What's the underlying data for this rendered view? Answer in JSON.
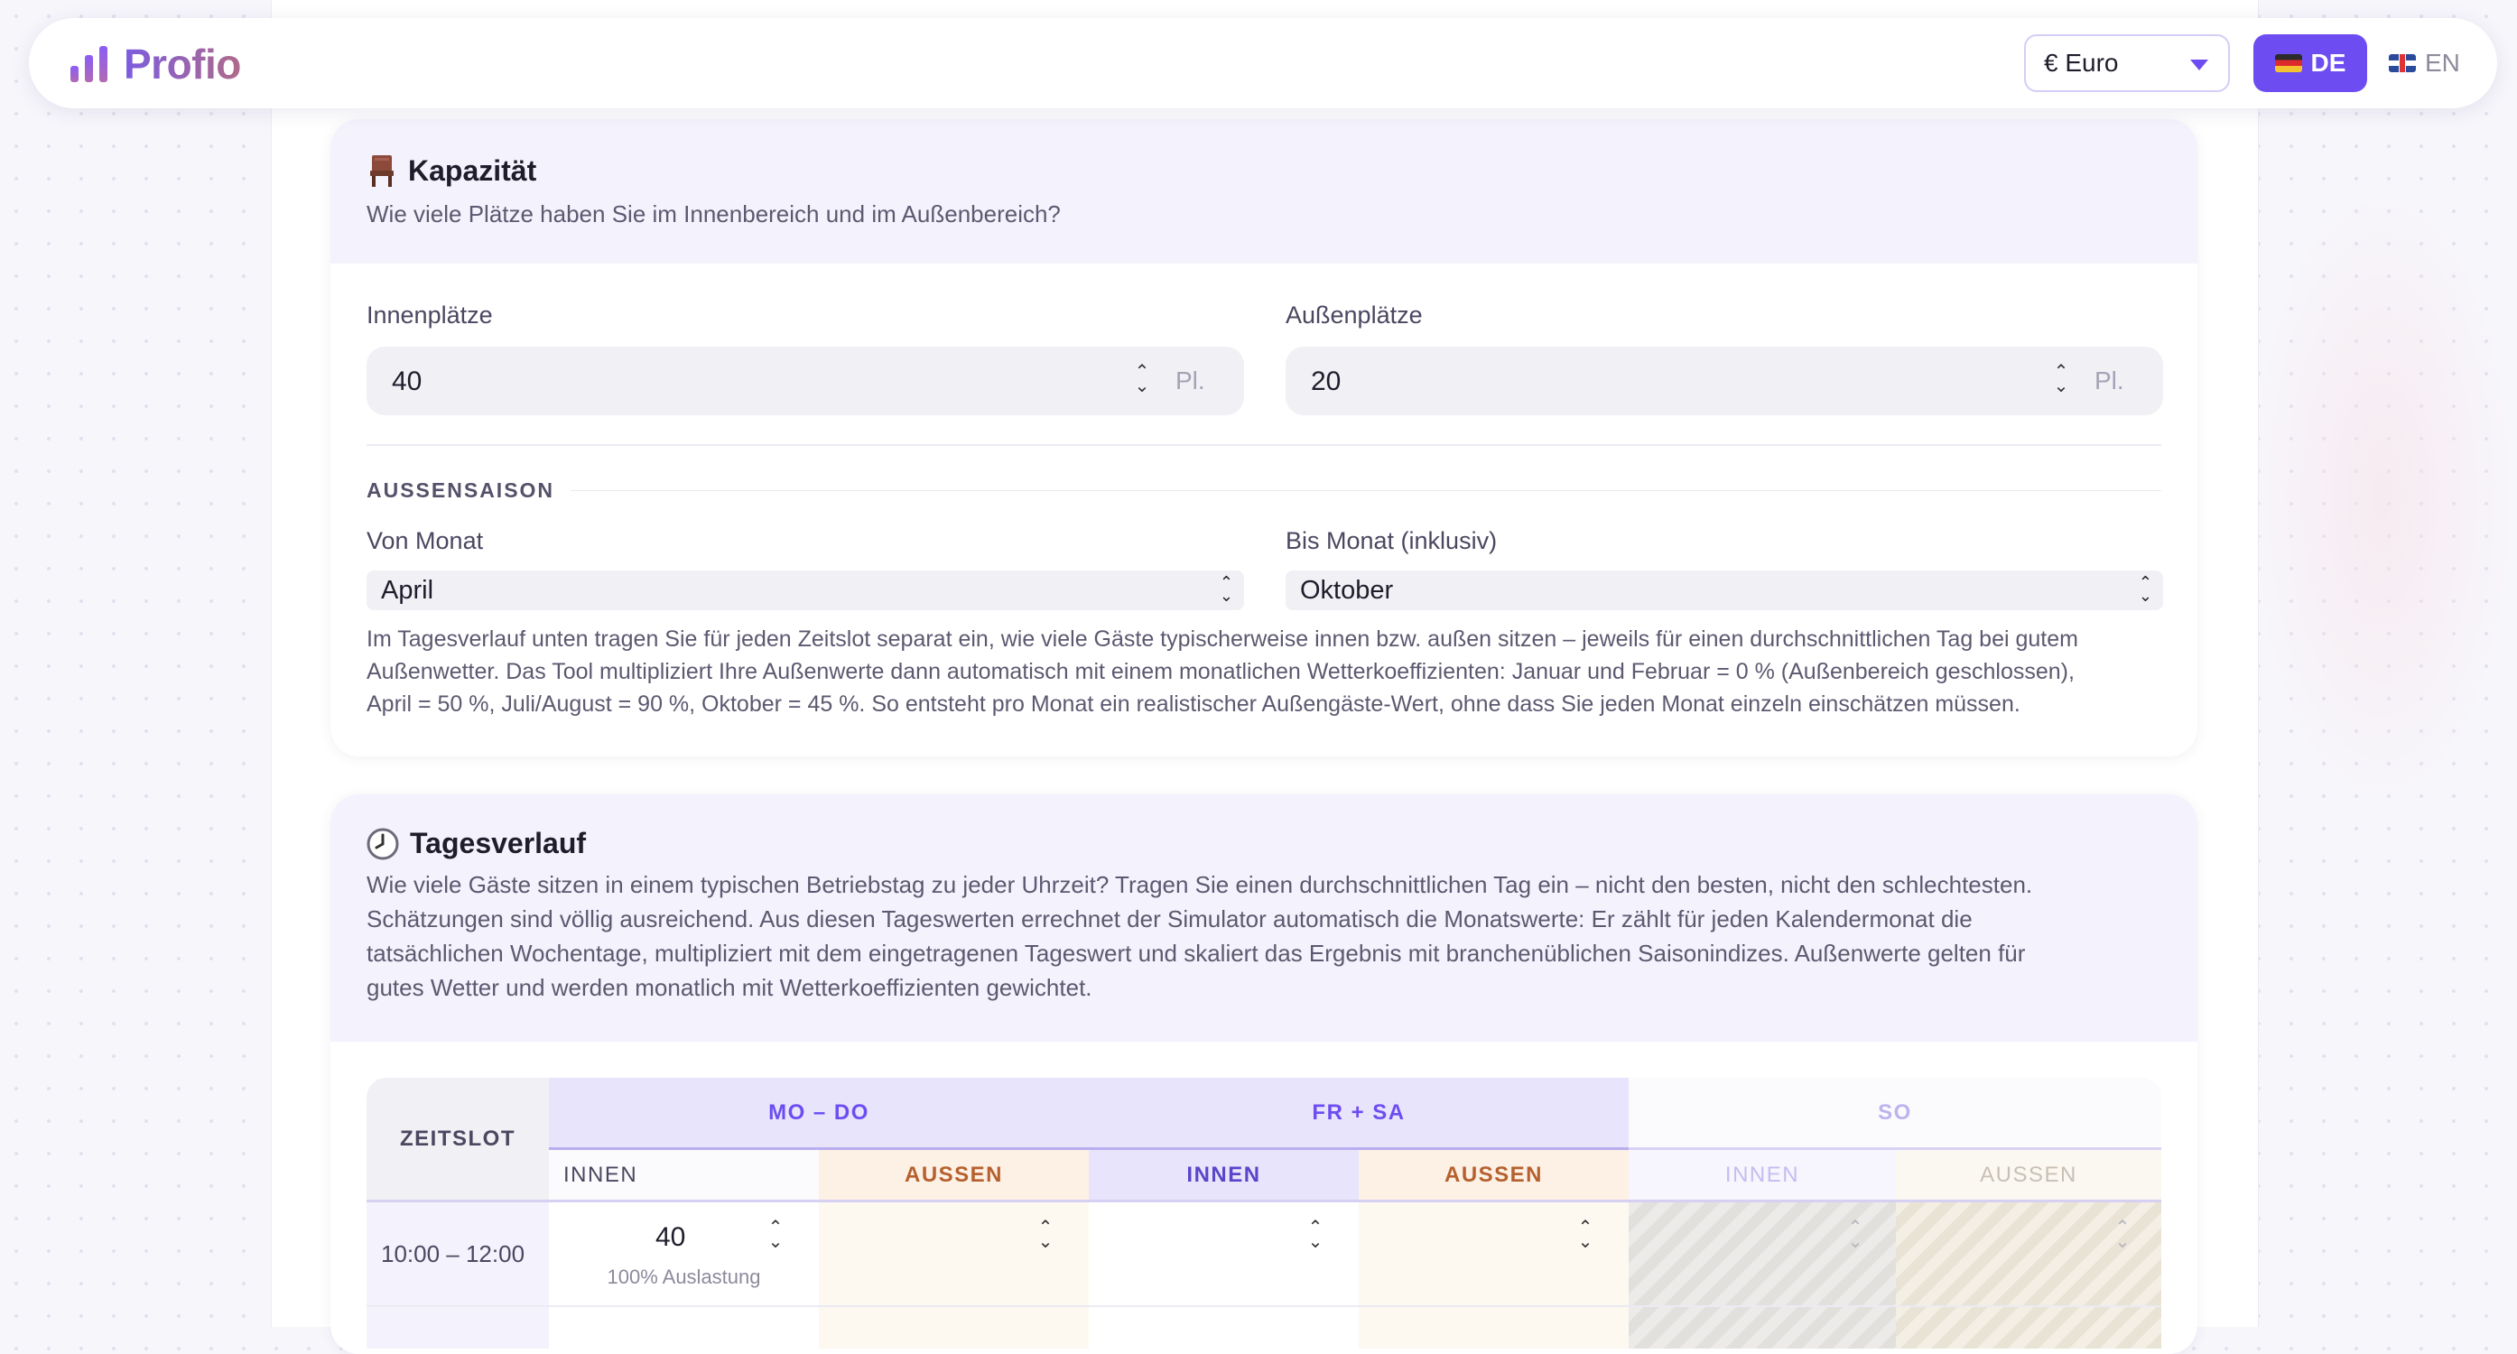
{
  "navbar": {
    "logo_text": "Profio",
    "currency_selected": "€ Euro",
    "lang_de": "DE",
    "lang_en": "EN"
  },
  "capacity": {
    "title": "Kapazität",
    "icon": "chair-icon",
    "description": "Wie viele Plätze haben Sie im Innenbereich und im Außenbereich?",
    "indoor_label": "Innenplätze",
    "indoor_value": "40",
    "indoor_unit": "Pl.",
    "outdoor_label": "Außenplätze",
    "outdoor_value": "20",
    "outdoor_unit": "Pl.",
    "season_label": "AUSSENSAISON",
    "from_label": "Von Monat",
    "from_value": "April",
    "to_label": "Bis Monat (inklusiv)",
    "to_value": "Oktober",
    "note_line1": "Im Tagesverlauf unten tragen Sie für jeden Zeitslot separat ein, wie viele Gäste typischerweise innen bzw. außen sitzen – jeweils für einen durchschnittlichen Tag bei gutem",
    "note_line2": "Außenwetter. Das Tool multipliziert Ihre Außenwerte dann automatisch mit einem monatlichen Wetterkoeffizienten: Januar und Februar = 0 % (Außenbereich geschlossen),",
    "note_line3": "April = 50 %, Juli/August = 90 %, Oktober = 45 %. So entsteht pro Monat ein realistischer Außengäste-Wert, ohne dass Sie jeden Monat einzeln einschätzen müssen."
  },
  "daily": {
    "title": "Tagesverlauf",
    "icon": "clock-icon",
    "desc_line1": "Wie viele Gäste sitzen in einem typischen Betriebstag zu jeder Uhrzeit? Tragen Sie einen durchschnittlichen Tag ein – nicht den besten, nicht den schlechtesten.",
    "desc_line2": "Schätzungen sind völlig ausreichend. Aus diesen Tageswerten errechnet der Simulator automatisch die Monatswerte: Er zählt für jeden Kalendermonat die",
    "desc_line3": "tatsächlichen Wochentage, multipliziert mit dem eingetragenen Tageswert und skaliert das Ergebnis mit branchenüblichen Saisonindizes. Außenwerte gelten für",
    "desc_line4": "gutes Wetter und werden monatlich mit Wetterkoeffizienten gewichtet.",
    "table": {
      "col_timeslot": "ZEITSLOT",
      "group_mo_do": "MO – DO",
      "group_fr_sa": "FR + SA",
      "group_so": "SO",
      "sub_innen": "INNEN",
      "sub_aussen": "AUSSEN",
      "rows": [
        {
          "timeslot": "10:00 – 12:00",
          "mo_do_innen": "40",
          "mo_do_innen_hint": "100% Auslastung",
          "mo_do_aussen": "",
          "fr_sa_innen": "",
          "fr_sa_aussen": "",
          "so_innen": "",
          "so_aussen": ""
        }
      ]
    }
  },
  "colors": {
    "accent": "#6d4df2",
    "header_band": "#f4f2fc",
    "innen_header": "#e6e2fb",
    "aussen_header": "#fdf0e4",
    "aussen_text": "#b5602e"
  }
}
